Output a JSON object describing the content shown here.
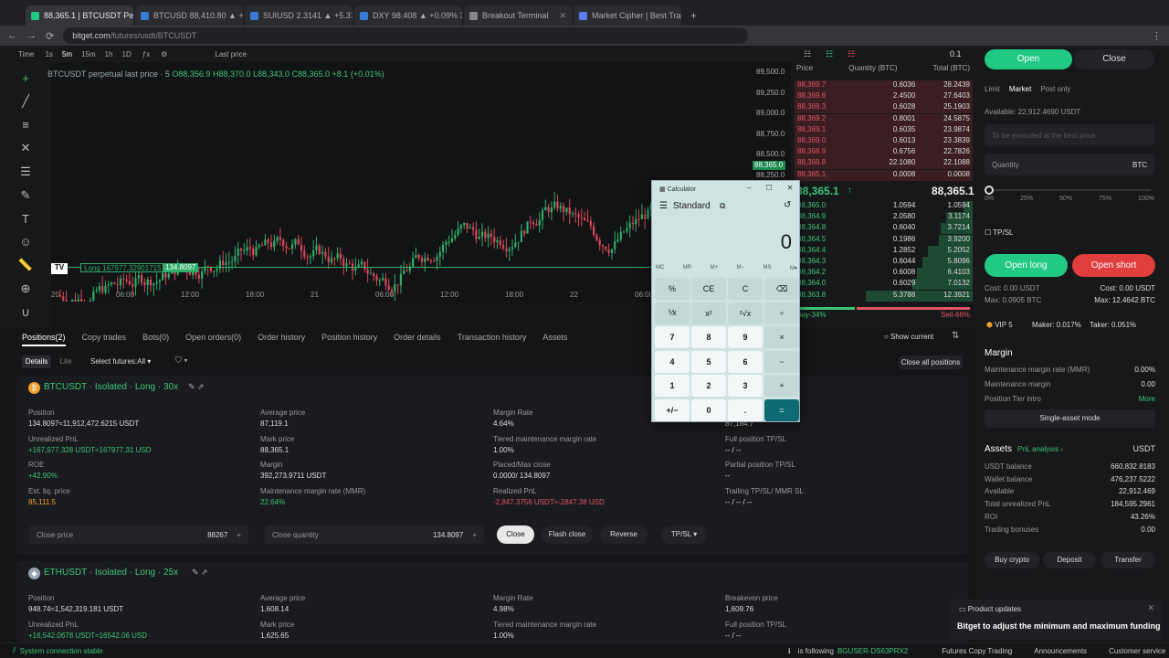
{
  "browser": {
    "tabs": [
      {
        "label": "88,365.1 | BTCUSDT Perpetual |",
        "color": "#22c983",
        "active": true
      },
      {
        "label": "BTCUSD 88,410.80 ▲ +1.03% 3",
        "color": "#3a7bd5",
        "active": false
      },
      {
        "label": "SUIUSD 2.3141 ▲ +5.37% 3amig",
        "color": "#3a7bd5",
        "active": false
      },
      {
        "label": "DXY 98.408 ▲ +0.09% 3amigo",
        "color": "#3a7bd5",
        "active": false
      },
      {
        "label": "Breakout Terminal",
        "color": "#888",
        "active": false
      },
      {
        "label": "Market Cipher | Best Trading To",
        "color": "#5b7cfa",
        "active": false
      }
    ],
    "url_host": "bitget.com",
    "url_path": "/futures/usdt/BTCUSDT"
  },
  "toolbar": {
    "time": "Time",
    "intervals": [
      "1s",
      "5m",
      "15m",
      "1h",
      "1D"
    ],
    "selected_interval": "5m",
    "price_mode": "Last price"
  },
  "chart": {
    "title": "BTCUSDT perpetual last price · 5",
    "ohlc": "O88,356.9 H88,370.0 L88,343.0 C88,365.0 +8.1 (+0.01%)",
    "price_ticks": [
      "89,500.0",
      "89,250.0",
      "89,000.0",
      "88,750.0",
      "88,500.0",
      "88,250.0"
    ],
    "current_price_tag": "88,365.0",
    "x_ticks": [
      "20",
      "06:00",
      "12:00",
      "18:00",
      "21",
      "06:00",
      "12:00",
      "18:00",
      "22",
      "06:00"
    ],
    "long_label": "Long 167977.32901715",
    "long_qty": "134.8097"
  },
  "orderbook": {
    "headers": [
      "Price",
      "Quantity (BTC)",
      "Total (BTC)"
    ],
    "precision": "0.1",
    "asks": [
      [
        "88,369.7",
        "0.6036",
        "28.2439"
      ],
      [
        "88,369.6",
        "2.4500",
        "27.6403"
      ],
      [
        "88,369.3",
        "0.6028",
        "25.1903"
      ],
      [
        "88,369.2",
        "0.8001",
        "24.5875"
      ],
      [
        "88,369.1",
        "0.6035",
        "23.9874"
      ],
      [
        "88,369.0",
        "0.6013",
        "23.3839"
      ],
      [
        "88,368.9",
        "0.6756",
        "22.7826"
      ],
      [
        "88,368.8",
        "22.1080",
        "22.1088"
      ],
      [
        "88,365.1",
        "0.0008",
        "0.0008"
      ]
    ],
    "mid_price": "88,365.1",
    "mid_mark": "88,365.1",
    "bids": [
      [
        "88,365.0",
        "1.0594",
        "1.0594"
      ],
      [
        "88,364.9",
        "2.0580",
        "3.1174"
      ],
      [
        "88,364.8",
        "0.6040",
        "3.7214"
      ],
      [
        "88,364.5",
        "0.1986",
        "3.9200"
      ],
      [
        "88,364.4",
        "1.2852",
        "5.2052"
      ],
      [
        "88,364.3",
        "0.6044",
        "5.8096"
      ],
      [
        "88,364.2",
        "0.6008",
        "6.4103"
      ],
      [
        "88,364.0",
        "0.6029",
        "7.0132"
      ],
      [
        "88,363.8",
        "5.3788",
        "12.3921"
      ]
    ],
    "buy_pct": "Buy-34%",
    "sell_pct": "Sell-66%"
  },
  "trade": {
    "open": "Open",
    "close": "Close",
    "order_types": [
      "Limit",
      "Market",
      "Post only"
    ],
    "available": "Available: 22,912.4690 USDT",
    "price_placeholder": "To be executed at the best price",
    "qty_label": "Quantity",
    "qty_unit": "BTC",
    "slider": [
      "0%",
      "25%",
      "50%",
      "75%",
      "100%"
    ],
    "tpsl": "TP/SL",
    "open_long": "Open long",
    "open_short": "Open short",
    "cost_long": "Cost: 0.00 USDT",
    "max_long": "Max: 0.0905 BTC",
    "cost_short": "Cost: 0.00 USDT",
    "max_short": "Max: 12.4642 BTC",
    "vip": "VIP 5",
    "maker": "Maker: 0.017%",
    "taker": "Taker: 0.051%",
    "margin_title": "Margin",
    "mmr_label": "Maintenance margin rate (MMR)",
    "mmr_val": "0.00%",
    "mm_label": "Maintenance margin",
    "mm_val": "0.00",
    "tier_label": "Position Tier intro",
    "tier_more": "More",
    "single_asset": "Single-asset mode",
    "assets_title": "Assets",
    "pnl_analysis": "PnL analysis ›",
    "asset_unit": "USDT",
    "assets": [
      [
        "USDT balance",
        "660,832.8183"
      ],
      [
        "Wallet balance",
        "476,237.5222"
      ],
      [
        "Available",
        "22,912.469"
      ],
      [
        "Total unrealized PnL",
        "184,595.2961"
      ],
      [
        "ROI",
        "43.26%"
      ],
      [
        "Trading bonuses",
        "0.00"
      ]
    ],
    "buy_crypto": "Buy crypto",
    "deposit": "Deposit",
    "transfer": "Transfer"
  },
  "bottom": {
    "tabs": [
      "Positions(2)",
      "Copy trades",
      "Bots(0)",
      "Open orders(0)",
      "Order history",
      "Position history",
      "Order details",
      "Transaction history",
      "Assets"
    ],
    "details": "Details",
    "lite": "Lite",
    "select_futures": "Select futures:All",
    "show_current": "Show current",
    "close_all": "Close all positions",
    "positions": [
      {
        "symbol": "BTCUSDT · Isolated · Long · 30x",
        "fields": [
          [
            "Position",
            "134.8097≈11,912,472.6215 USDT"
          ],
          [
            "Average price",
            "87,119.1"
          ],
          [
            "Margin Rate",
            "4.64%"
          ],
          [
            "Breakeven price",
            "87,184.7"
          ],
          [
            "Unrealized PnL",
            "+167,977.328 USDT≈167977.31 USD"
          ],
          [
            "Mark price",
            "88,365.1"
          ],
          [
            "Tiered maintenance margin rate",
            "1.00%"
          ],
          [
            "Full position TP/SL",
            "-- / --"
          ],
          [
            "ROE",
            "+42.90%"
          ],
          [
            "Margin",
            "392,273.9711 USDT"
          ],
          [
            "Placed/Max close",
            "0.0000/ 134.8097"
          ],
          [
            "Partial position TP/SL",
            "--"
          ],
          [
            "Est. liq. price",
            "85,111.5"
          ],
          [
            "Maintenance margin rate (MMR)",
            "22.64%"
          ],
          [
            "Realized PnL",
            "-2,847.3756 USDT≈-2847.38 USD"
          ],
          [
            "Trailing TP/SL/ MMR SL",
            "-- / -- / --"
          ]
        ],
        "close_price_label": "Close price",
        "close_price_val": "88267",
        "close_qty_label": "Close quantity",
        "close_qty_val": "134.8097",
        "close_btn": "Close",
        "flash_close": "Flash close",
        "reverse": "Reverse",
        "tpsl_btn": "TP/SL"
      },
      {
        "symbol": "ETHUSDT · Isolated · Long · 25x",
        "fields": [
          [
            "Position",
            "948.74≈1,542,319.181 USDT"
          ],
          [
            "Average price",
            "1,608.14"
          ],
          [
            "Margin Rate",
            "4.98%"
          ],
          [
            "Breakeven price",
            "1,609.76"
          ],
          [
            "Unrealized PnL",
            "+16,542.0678 USDT≈16542.06 USD"
          ],
          [
            "Mark price",
            "1,625.65"
          ],
          [
            "Tiered maintenance margin rate",
            "1.00%"
          ],
          [
            "Full position TP/SL",
            "-- / --"
          ]
        ]
      }
    ]
  },
  "calculator": {
    "title": "Calculator",
    "mode": "Standard",
    "display": "0",
    "memory": [
      "MC",
      "MR",
      "M+",
      "M−",
      "MS",
      "M▾"
    ],
    "keys": [
      [
        "%",
        "CE",
        "C",
        "⌫"
      ],
      [
        "⅟x",
        "x²",
        "²√x",
        "÷"
      ],
      [
        "7",
        "8",
        "9",
        "×"
      ],
      [
        "4",
        "5",
        "6",
        "−"
      ],
      [
        "1",
        "2",
        "3",
        "+"
      ],
      [
        "+/−",
        "0",
        ".",
        "="
      ]
    ]
  },
  "status": {
    "connection": "System connection stable",
    "following": "is following",
    "follow_id": "BGUSER-DS63PRX2",
    "links": [
      "Futures Copy Trading",
      "Announcements",
      "Customer service"
    ]
  },
  "toast": {
    "title": "Product updates",
    "body": "Bitget to adjust the minimum and maximum funding"
  }
}
